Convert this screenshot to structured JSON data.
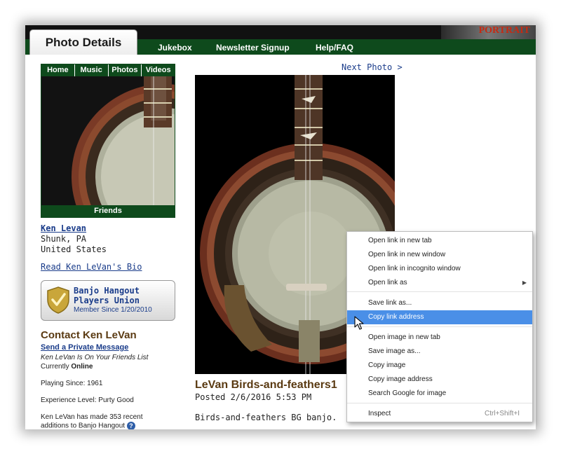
{
  "header": {
    "tab_title": "Photo Details",
    "nav": [
      "Jukebox",
      "Newsletter Signup",
      "Help/FAQ"
    ],
    "banner_text": "PORTRAIT"
  },
  "profile": {
    "mini_nav": [
      "Home",
      "Music",
      "Photos",
      "Videos"
    ],
    "friends_label": "Friends",
    "name": "Ken Levan",
    "city": "Shunk, PA",
    "country": "United States",
    "bio_link": "Read Ken LeVan's Bio",
    "union_title": "Banjo Hangout Players Union",
    "union_since": "Member Since 1/20/2010",
    "contact_title": "Contact Ken LeVan",
    "message_link": "Send a Private Message",
    "friends_note": "Ken LeVan Is On Your Friends List",
    "status_label": "Currently",
    "status_value": "Online",
    "playing_since": "Playing Since: 1961",
    "experience": "Experience Level: Purty Good",
    "recent_line1": "Ken LeVan has made 353 recent",
    "recent_line2": "additions to Banjo Hangout"
  },
  "photo": {
    "next_link": "Next Photo >",
    "title": "LeVan Birds-and-feathers1",
    "posted": "Posted 2/6/2016 5:53 PM",
    "description": "Birds-and-feathers BG banjo."
  },
  "context_menu": {
    "items": [
      {
        "label": "Open link in new tab"
      },
      {
        "label": "Open link in new window"
      },
      {
        "label": "Open link in incognito window"
      },
      {
        "label": "Open link as",
        "submenu": true
      },
      {
        "label": "Save link as..."
      },
      {
        "label": "Copy link address",
        "highlighted": true
      },
      {
        "label": "Open image in new tab"
      },
      {
        "label": "Save image as..."
      },
      {
        "label": "Copy image"
      },
      {
        "label": "Copy image address"
      },
      {
        "label": "Search Google for image"
      },
      {
        "label": "Inspect",
        "shortcut": "Ctrl+Shift+I"
      }
    ]
  },
  "colors": {
    "nav_green": "#0e4a1c",
    "link_blue": "#1a3c8a",
    "title_brown": "#5a3a12",
    "menu_highlight": "#4a8fe7"
  }
}
